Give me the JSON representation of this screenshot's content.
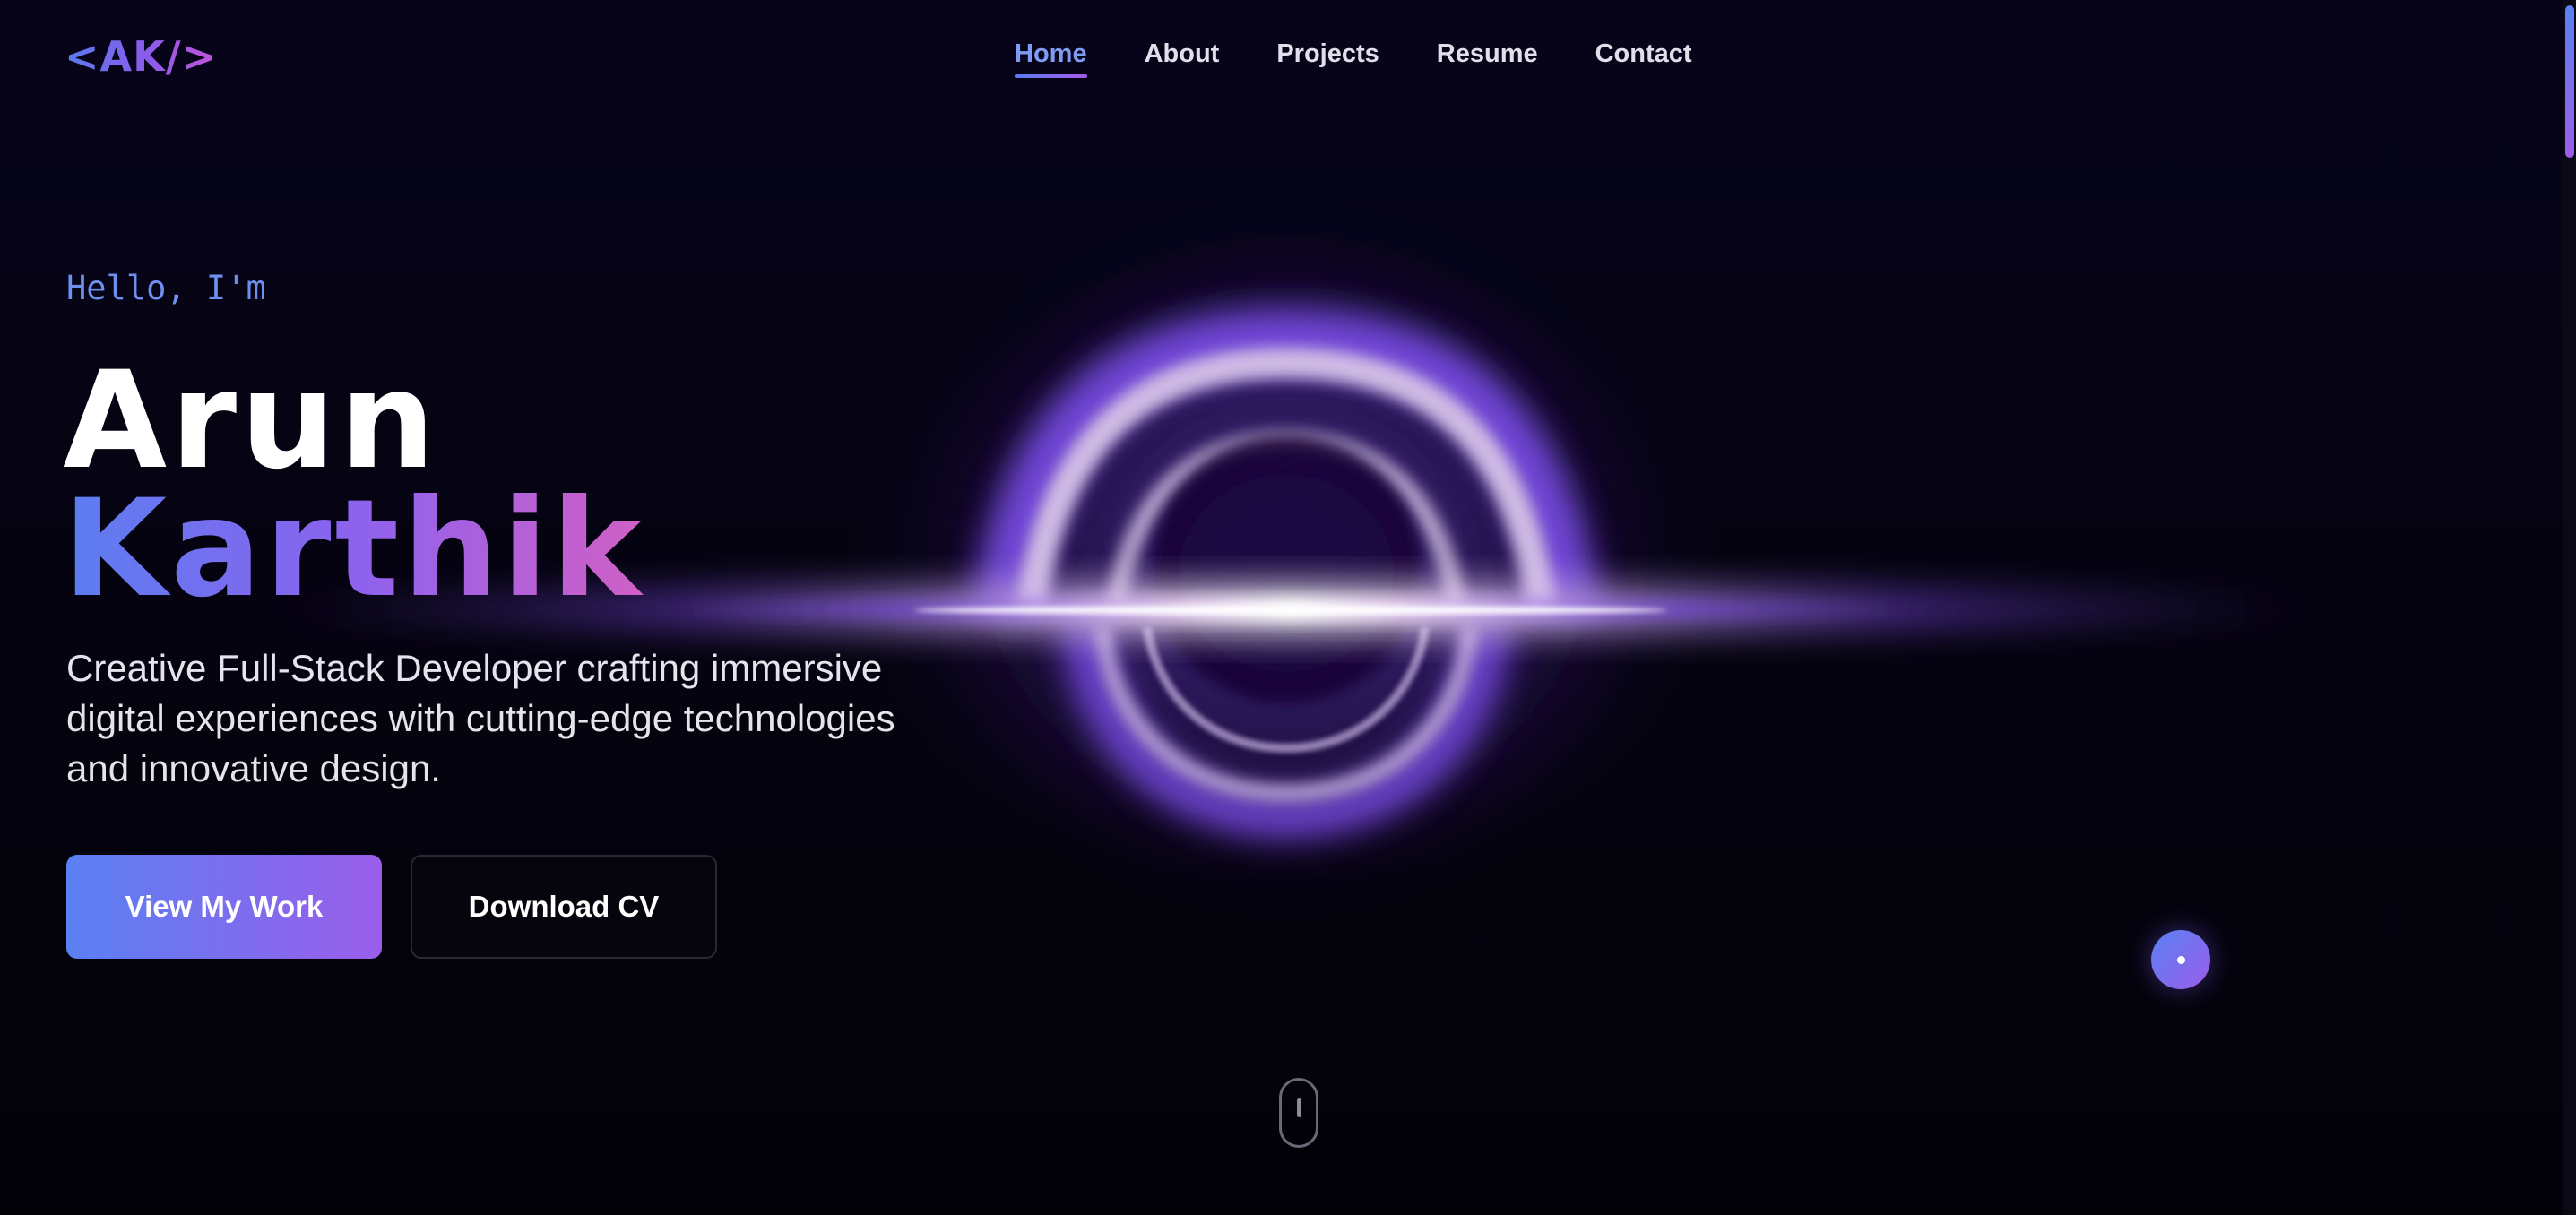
{
  "brand": {
    "logo": "<AK/>"
  },
  "nav": {
    "items": [
      {
        "label": "Home",
        "active": true
      },
      {
        "label": "About",
        "active": false
      },
      {
        "label": "Projects",
        "active": false
      },
      {
        "label": "Resume",
        "active": false
      },
      {
        "label": "Contact",
        "active": false
      }
    ]
  },
  "hero": {
    "greeting": "Hello, I'm",
    "first_name": "Arun",
    "last_name": "Karthik",
    "tagline": "Creative Full-Stack Developer crafting immersive digital experiences with cutting-edge technologies and innovative design.",
    "primary_button": "View My Work",
    "secondary_button": "Download CV"
  },
  "icons": {
    "chat": "chat-bubble-icon",
    "scroll": "mouse-scroll-icon",
    "visual": "black-hole-visual"
  },
  "colors": {
    "accent_blue": "#5a80f2",
    "accent_purple": "#9a5eea",
    "accent_pink": "#d160c6",
    "background": "#05030d"
  }
}
